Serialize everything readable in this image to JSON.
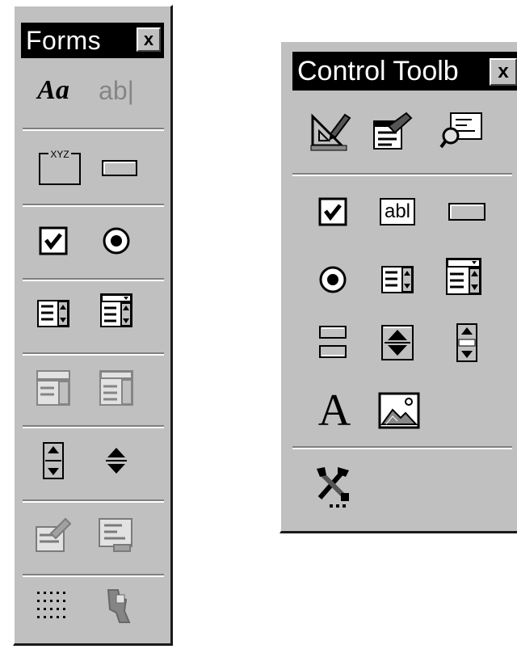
{
  "forms": {
    "title": "Forms",
    "close_glyph": "x",
    "label_tool_text": "Aa",
    "edit_box_text": "ab|",
    "groupbox_caption": "XYZ",
    "tools": [
      {
        "name": "label-icon",
        "enabled": true
      },
      {
        "name": "edit-box-icon",
        "enabled": false
      },
      {
        "name": "group-box-icon",
        "enabled": true
      },
      {
        "name": "button-icon",
        "enabled": true
      },
      {
        "name": "checkbox-icon",
        "enabled": true
      },
      {
        "name": "option-button-icon",
        "enabled": true
      },
      {
        "name": "list-box-icon",
        "enabled": true
      },
      {
        "name": "combo-box-icon",
        "enabled": true
      },
      {
        "name": "combination-list-edit-icon",
        "enabled": false
      },
      {
        "name": "combination-dropdown-edit-icon",
        "enabled": false
      },
      {
        "name": "scroll-bar-icon",
        "enabled": true
      },
      {
        "name": "spinner-icon",
        "enabled": true
      },
      {
        "name": "control-properties-icon",
        "enabled": false
      },
      {
        "name": "edit-code-icon",
        "enabled": false
      },
      {
        "name": "toggle-grid-icon",
        "enabled": true
      },
      {
        "name": "run-dialog-icon",
        "enabled": false
      }
    ]
  },
  "control_toolbox": {
    "title": "Control Toolb",
    "close_glyph": "x",
    "textbox_text": "abl",
    "label_glyph": "A",
    "tools": [
      {
        "name": "design-mode-icon"
      },
      {
        "name": "properties-icon"
      },
      {
        "name": "view-code-icon"
      },
      {
        "name": "checkbox-icon"
      },
      {
        "name": "textbox-icon"
      },
      {
        "name": "command-button-icon"
      },
      {
        "name": "option-button-icon"
      },
      {
        "name": "list-box-icon"
      },
      {
        "name": "combo-box-icon"
      },
      {
        "name": "toggle-button-icon"
      },
      {
        "name": "spin-button-icon"
      },
      {
        "name": "scroll-bar-icon"
      },
      {
        "name": "label-icon"
      },
      {
        "name": "image-icon"
      },
      {
        "name": "more-controls-icon"
      }
    ]
  }
}
